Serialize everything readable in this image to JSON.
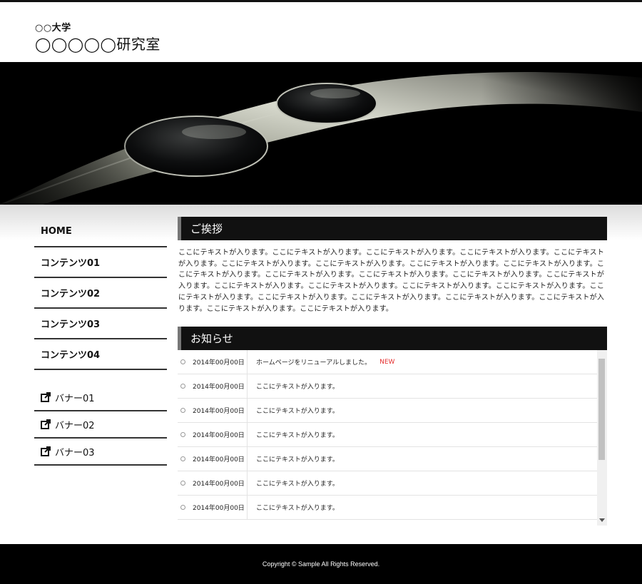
{
  "header": {
    "university": "○○大学",
    "lab_name": "◯◯◯◯◯研究室"
  },
  "nav": {
    "items": [
      {
        "label": "HOME"
      },
      {
        "label": "コンテンツ01"
      },
      {
        "label": "コンテンツ02"
      },
      {
        "label": "コンテンツ03"
      },
      {
        "label": "コンテンツ04"
      }
    ],
    "banners": [
      {
        "label": "バナー01",
        "icon": "external-link-icon"
      },
      {
        "label": "バナー02",
        "icon": "external-link-icon"
      },
      {
        "label": "バナー03",
        "icon": "external-link-icon"
      }
    ]
  },
  "greeting": {
    "title": "ご挨拶",
    "body": "ここにテキストが入ります。ここにテキストが入ります。ここにテキストが入ります。ここにテキストが入ります。ここにテキストが入ります。ここにテキストが入ります。ここにテキストが入ります。ここにテキストが入ります。ここにテキストが入ります。ここにテキストが入ります。ここにテキストが入ります。ここにテキストが入ります。ここにテキストが入ります。ここにテキストが入ります。ここにテキストが入ります。ここにテキストが入ります。ここにテキストが入ります。ここにテキストが入ります。ここにテキストが入ります。ここにテキストが入ります。ここにテキストが入ります。ここにテキストが入ります。ここにテキストが入ります。ここにテキストが入ります。ここにテキストが入ります。"
  },
  "news": {
    "title": "お知らせ",
    "items": [
      {
        "date": "2014年00月00日",
        "text": "ホームページをリニューアルしました。",
        "badge": "NEW"
      },
      {
        "date": "2014年00月00日",
        "text": "ここにテキストが入ります。"
      },
      {
        "date": "2014年00月00日",
        "text": "ここにテキストが入ります。"
      },
      {
        "date": "2014年00月00日",
        "text": "ここにテキストが入ります。"
      },
      {
        "date": "2014年00月00日",
        "text": "ここにテキストが入ります。"
      },
      {
        "date": "2014年00月00日",
        "text": "ここにテキストが入ります。"
      },
      {
        "date": "2014年00月00日",
        "text": "ここにテキストが入ります。"
      }
    ],
    "badge_color": "#e53030"
  },
  "footer": {
    "copyright": "Copyright © Sample All Rights Reserved."
  },
  "colors": {
    "header_bar": "#111111",
    "footer_bg": "#000000",
    "section_head_bg": "#111111"
  }
}
